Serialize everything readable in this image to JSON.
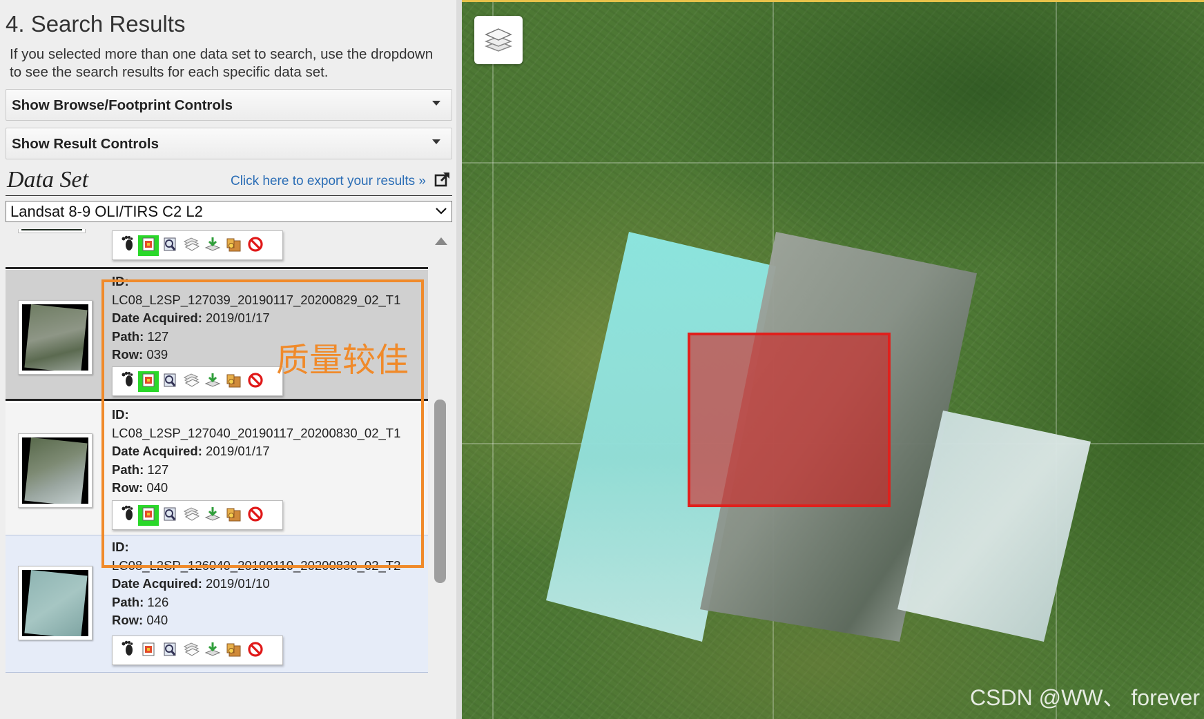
{
  "panel": {
    "heading": "4. Search Results",
    "intro": "If you selected more than one data set to search, use the dropdown to see the search results for each specific data set.",
    "browse_controls": "Show Browse/Footprint Controls",
    "result_controls": "Show Result Controls",
    "dataset_title": "Data Set",
    "export_link": "Click here to export your results »",
    "dataset_selected": "Landsat 8-9 OLI/TIRS C2 L2"
  },
  "labels": {
    "id": "ID:",
    "date": "Date Acquired:",
    "path": "Path:",
    "row": "Row:"
  },
  "results": [
    {
      "id": "LC08_L2SP_127039_20190117_20200829_02_T1",
      "date": "2019/01/17",
      "path": "127",
      "row": "039",
      "footprint_on": true
    },
    {
      "id": "LC08_L2SP_127040_20190117_20200830_02_T1",
      "date": "2019/01/17",
      "path": "127",
      "row": "040",
      "footprint_on": true
    },
    {
      "id": "LC08_L2SP_126040_20190110_20200830_02_T2",
      "date": "2019/01/10",
      "path": "126",
      "row": "040",
      "footprint_on": false
    }
  ],
  "toolbar_icons": [
    "footprint-icon",
    "overlay-icon",
    "metadata-icon",
    "compare-icon",
    "download-icon",
    "order-icon",
    "exclude-icon"
  ],
  "annotation": "质量较佳",
  "watermark": "CSDN @WW、 forever",
  "colors": {
    "highlight": "#f08a2a",
    "link": "#2a6db5",
    "selected_row": "#d0d0d0",
    "alt_row": "#e6ecf8",
    "footprint_on": "#2ad82a",
    "aoi": "#e0201c"
  }
}
